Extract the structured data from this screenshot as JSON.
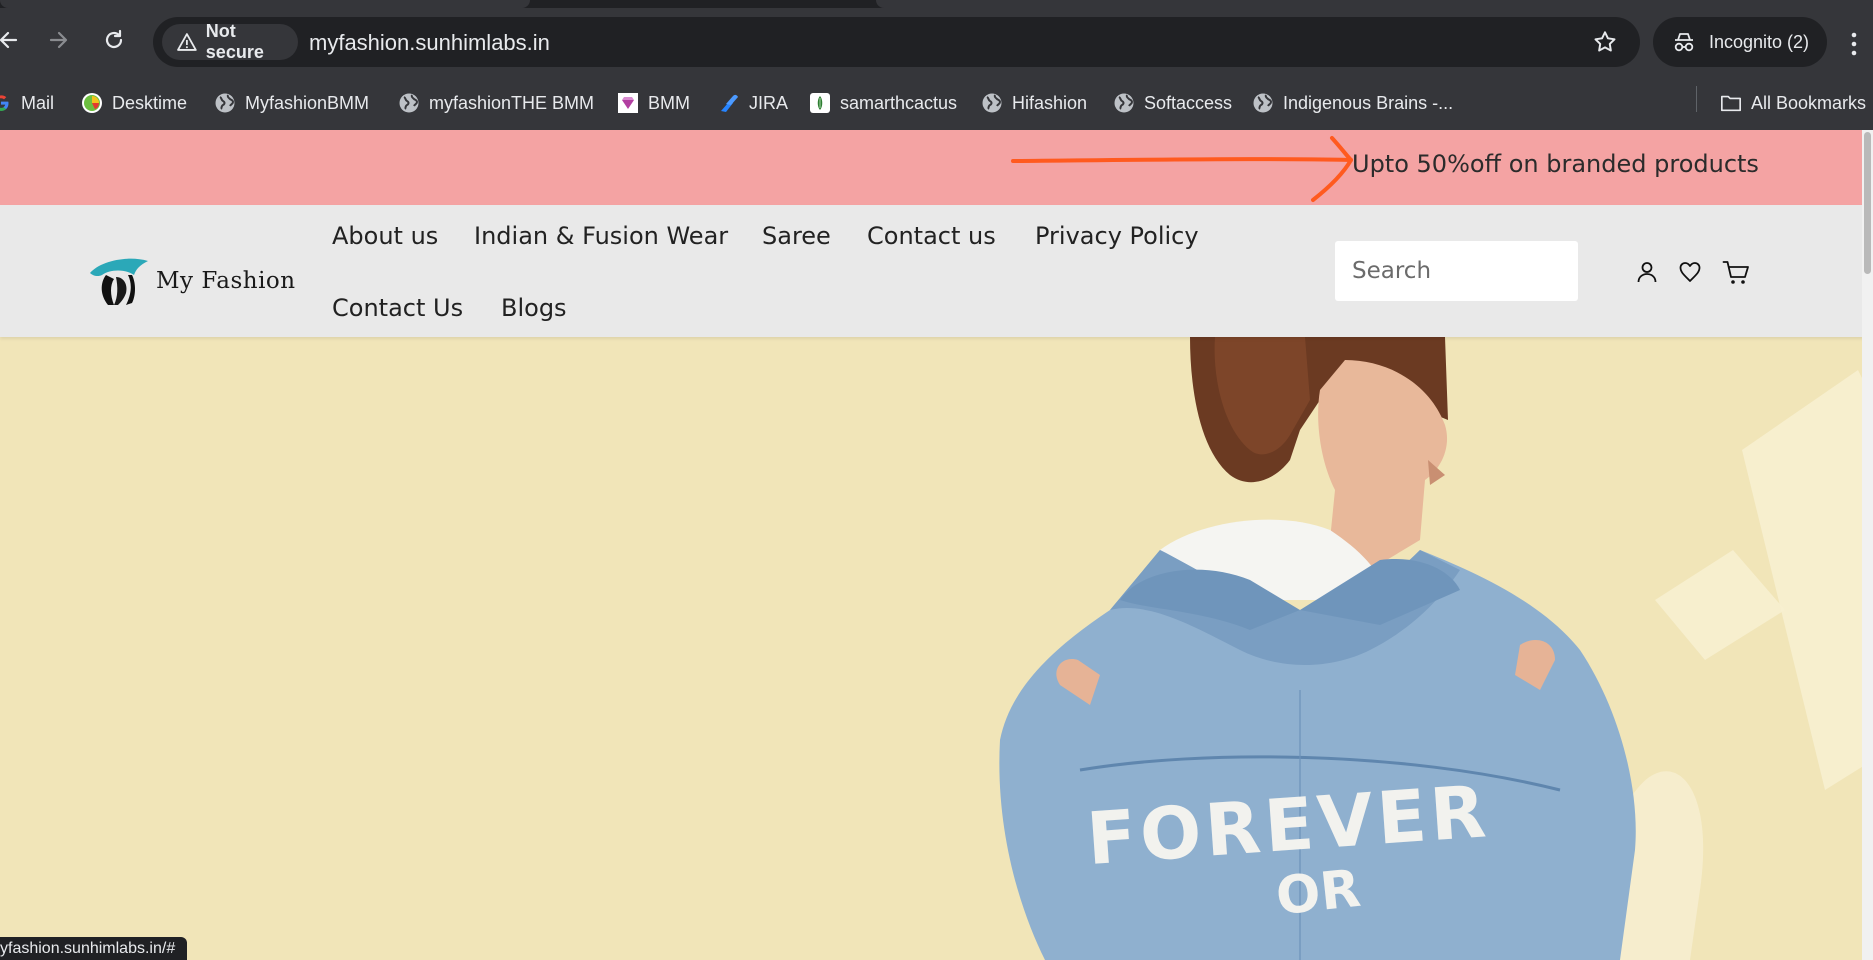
{
  "browser": {
    "security_label": "Not secure",
    "url": "myfashion.sunhimlabs.in",
    "incognito_label": "Incognito (2)",
    "status_url": "yfashion.sunhimlabs.in/#"
  },
  "bookmarks": [
    {
      "label": "Mail",
      "icon": "google-icon"
    },
    {
      "label": "Desktime",
      "icon": "desktime-icon"
    },
    {
      "label": "MyfashionBMM",
      "icon": "globe-icon"
    },
    {
      "label": "myfashionTHE BMM",
      "icon": "globe-icon"
    },
    {
      "label": "BMM",
      "icon": "bmm-icon"
    },
    {
      "label": "JIRA",
      "icon": "jira-icon"
    },
    {
      "label": "samarthcactus",
      "icon": "cactus-icon"
    },
    {
      "label": "Hifashion",
      "icon": "globe-icon"
    },
    {
      "label": "Softaccess",
      "icon": "globe-icon"
    },
    {
      "label": "Indigenous Brains -...",
      "icon": "globe-icon"
    }
  ],
  "all_bookmarks_label": "All Bookmarks",
  "promo": {
    "text": "Upto 50%off on branded products",
    "arrow_color": "#ff5a1f",
    "bg_color": "#f4a3a3"
  },
  "header": {
    "logo_text": "My Fashion",
    "nav": [
      "About us",
      "Indian & Fusion Wear",
      "Saree",
      "Contact us",
      "Privacy Policy",
      "Contact Us",
      "Blogs"
    ],
    "search_placeholder": "Search"
  },
  "hero": {
    "bg_color": "#f1e5b8",
    "jacket_text_line1": "FOREVER",
    "jacket_text_line2": "OR"
  }
}
